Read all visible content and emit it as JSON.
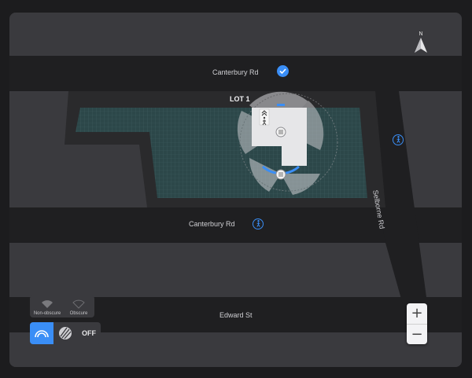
{
  "map": {
    "roads": {
      "top": "Canterbury Rd",
      "middle": "Canterbury Rd",
      "bottom": "Edward St",
      "right": "Selborne Rd"
    },
    "lot_label": "LOT 1",
    "north_label": "N",
    "colors": {
      "accent": "#3a8ef6",
      "road": "#1e1e20",
      "block": "#3a3a3e",
      "grid": "#2f4b4e"
    }
  },
  "zoom": {
    "in_label": "+",
    "out_label": "−"
  },
  "obscure_panel": {
    "non_obscure_label": "Non-obscure",
    "obscure_label": "Obscure"
  },
  "mode_bar": {
    "off_label": "OFF",
    "selected": "arc"
  }
}
